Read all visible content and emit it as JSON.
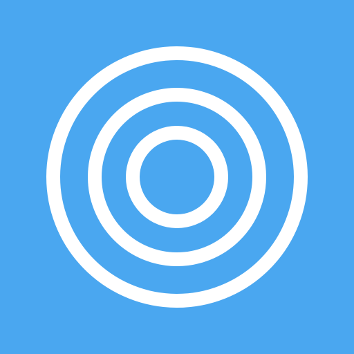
{
  "icon": {
    "name": "concentric-rings-icon",
    "background_color": "#4AA7F0",
    "ring_color": "#FFFFFF",
    "ring_count": 3
  }
}
